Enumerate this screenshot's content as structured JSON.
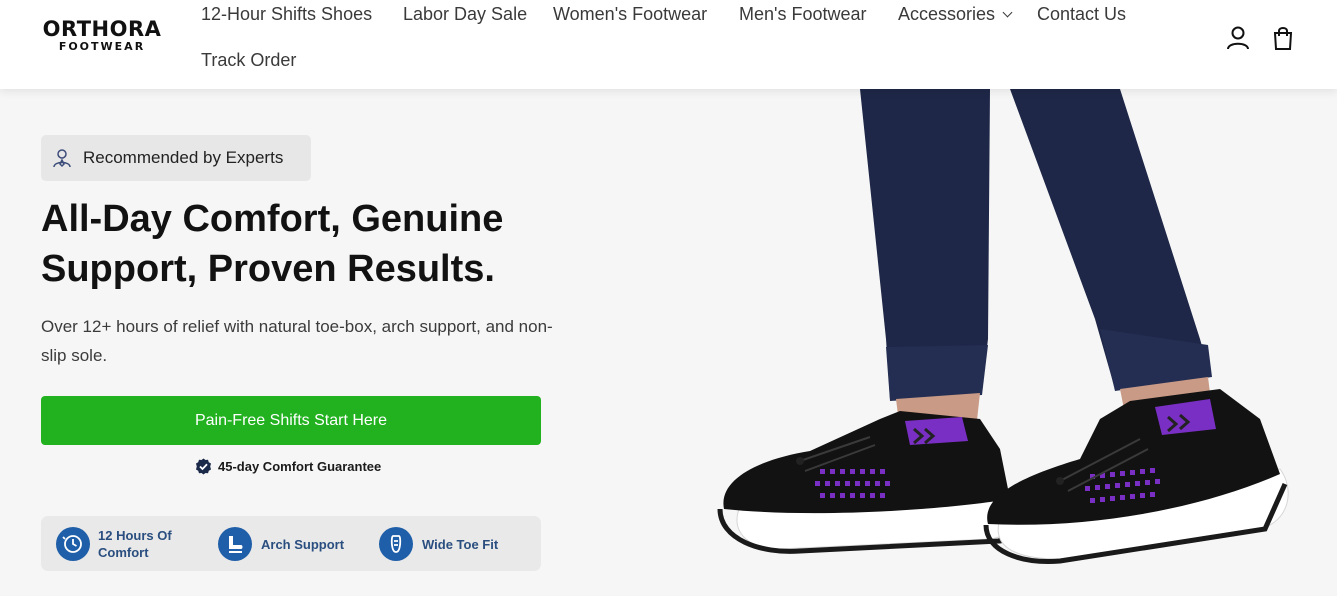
{
  "brand": {
    "name": "ORTHORA",
    "sub": "FOOTWEAR"
  },
  "nav": {
    "items": [
      {
        "label": "12-Hour Shifts Shoes"
      },
      {
        "label": "Labor Day Sale"
      },
      {
        "label": "Women's Footwear"
      },
      {
        "label": "Men's Footwear"
      },
      {
        "label": "Accessories"
      },
      {
        "label": "Contact Us"
      },
      {
        "label": "Track Order"
      }
    ]
  },
  "header_icons": {
    "account": "user-icon",
    "cart": "shopping-bag-icon"
  },
  "hero": {
    "badge": {
      "icon": "expert-icon",
      "label": "Recommended by Experts"
    },
    "headline_line1": "All-Day Comfort, Genuine",
    "headline_line2": "Support, Proven Results.",
    "subtext": "Over 12+ hours of relief with natural toe-box, arch support, and non-slip sole.",
    "cta_label": "Pain-Free Shifts Start Here",
    "guarantee": {
      "icon": "verified-badge-icon",
      "label": "45-day Comfort Guarantee"
    },
    "features": [
      {
        "icon": "clock-icon",
        "line1": "12 Hours Of",
        "line2": "Comfort"
      },
      {
        "icon": "arch-support-icon",
        "line1": "Arch Support"
      },
      {
        "icon": "wide-toe-icon",
        "line1": "Wide Toe Fit"
      }
    ]
  },
  "colors": {
    "cta": "#22b21f",
    "feature_icon": "#1f5ea8",
    "feature_text": "#2a4e7f",
    "pants": "#1e2747",
    "shoe_accent": "#7a2fc4"
  }
}
